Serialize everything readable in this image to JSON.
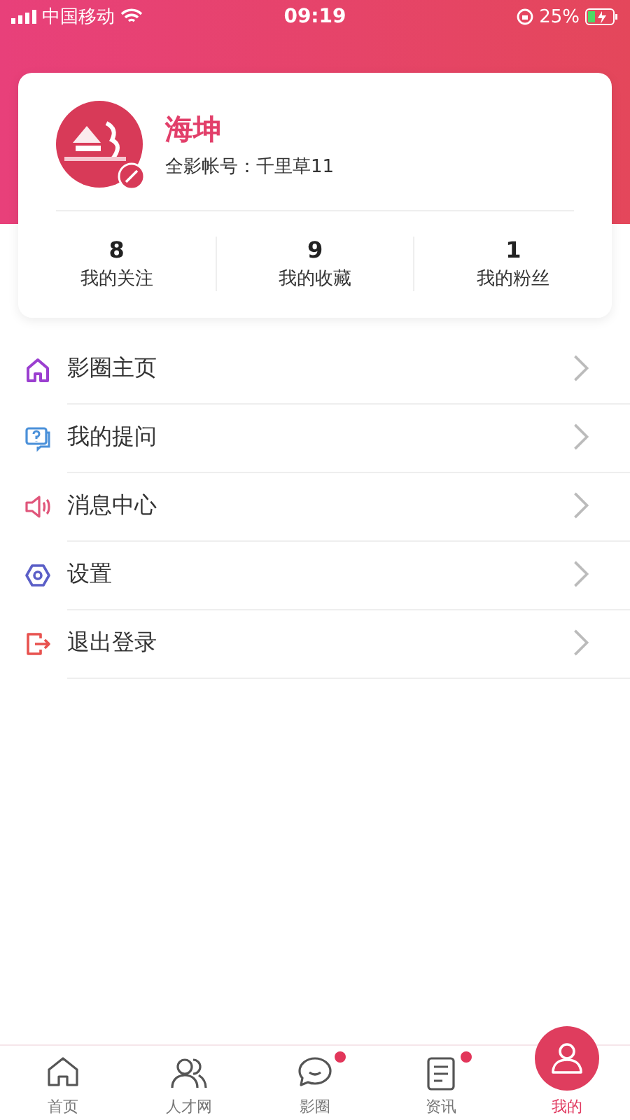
{
  "status_bar": {
    "carrier": "中国移动",
    "time": "09:19",
    "battery": "25%"
  },
  "profile": {
    "name": "海坤",
    "account": "全影帐号：千里草11"
  },
  "stats": [
    {
      "value": "8",
      "label": "我的关注"
    },
    {
      "value": "9",
      "label": "我的收藏"
    },
    {
      "value": "1",
      "label": "我的粉丝"
    }
  ],
  "menu": [
    {
      "kind": "home",
      "label": "影圈主页",
      "color": "#9b3fd0"
    },
    {
      "kind": "question",
      "label": "我的提问",
      "color": "#4a90d9"
    },
    {
      "kind": "speaker",
      "label": "消息中心",
      "color": "#e0557a"
    },
    {
      "kind": "settings",
      "label": "设置",
      "color": "#5b5fc7"
    },
    {
      "kind": "logout",
      "label": "退出登录",
      "color": "#e8524f"
    }
  ],
  "tab_bar": [
    {
      "kind": "home",
      "label": "首页",
      "selected": false,
      "badge": false
    },
    {
      "kind": "people",
      "label": "人才网",
      "selected": false,
      "badge": false
    },
    {
      "kind": "chat",
      "label": "影圈",
      "selected": false,
      "badge": true
    },
    {
      "kind": "news",
      "label": "资讯",
      "selected": false,
      "badge": true
    },
    {
      "kind": "user",
      "label": "我的",
      "selected": true,
      "badge": false
    }
  ]
}
